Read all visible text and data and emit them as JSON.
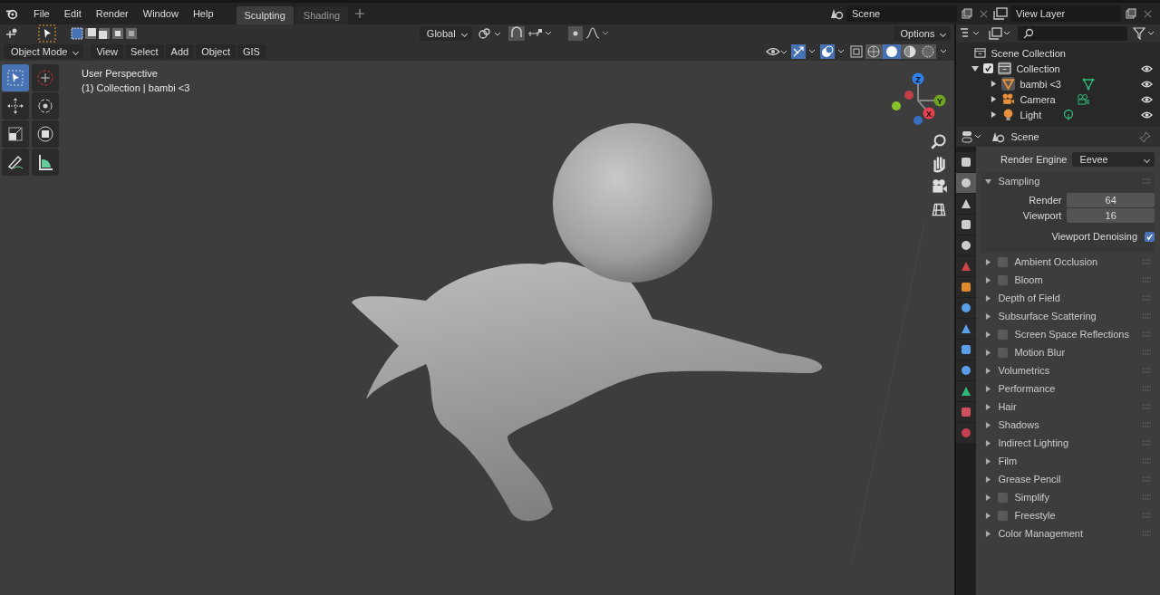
{
  "top_bar": {
    "menus": [
      "File",
      "Edit",
      "Render",
      "Window",
      "Help"
    ],
    "workspaces": [
      {
        "label": "Sculpting",
        "selected": true
      },
      {
        "label": "Shading",
        "selected": false
      }
    ],
    "scene": "Scene",
    "view_layer": "View Layer"
  },
  "tool_header": {
    "orientation": "Global",
    "options": "Options"
  },
  "viewport_header": {
    "mode": "Object Mode",
    "menus": [
      "View",
      "Select",
      "Add",
      "Object",
      "GIS"
    ]
  },
  "viewport": {
    "overlay_text": [
      "User Perspective",
      "(1) Collection | bambi <3"
    ],
    "tools": [
      {
        "kind": "select",
        "selected": true
      },
      {
        "kind": "cursor",
        "selected": false
      },
      {
        "kind": "move",
        "selected": false
      },
      {
        "kind": "rotate",
        "selected": false
      },
      {
        "kind": "scale",
        "selected": false
      },
      {
        "kind": "transform",
        "selected": false
      },
      {
        "kind": "annotate",
        "selected": false
      },
      {
        "kind": "measure",
        "selected": false
      }
    ],
    "gizmo_axes": [
      {
        "label": "Z",
        "color": "#2f7fe8"
      },
      {
        "label": "Y",
        "color": "#6ea21f"
      },
      {
        "label": "X",
        "color": "#e8414f"
      }
    ]
  },
  "outliner": {
    "root": "Scene Collection",
    "items": [
      {
        "label": "Collection",
        "kind": "collection",
        "checked": true,
        "expanded": true,
        "children": [
          {
            "label": "bambi <3",
            "kind": "mesh",
            "expanded": false
          },
          {
            "label": "Camera",
            "kind": "camera",
            "expanded": false
          },
          {
            "label": "Light",
            "kind": "light",
            "expanded": false
          }
        ]
      }
    ]
  },
  "properties": {
    "context": "Scene",
    "tabs": [
      {
        "kind": "tool",
        "selected": false
      },
      {
        "kind": "render",
        "selected": true
      },
      {
        "kind": "output",
        "selected": false
      },
      {
        "kind": "view_layer",
        "selected": false
      },
      {
        "kind": "scene",
        "selected": false
      },
      {
        "kind": "world",
        "selected": false
      },
      {
        "kind": "object",
        "selected": false
      },
      {
        "kind": "modifier",
        "selected": false
      },
      {
        "kind": "particles",
        "selected": false
      },
      {
        "kind": "physics",
        "selected": false
      },
      {
        "kind": "constraint",
        "selected": false
      },
      {
        "kind": "data",
        "selected": false
      },
      {
        "kind": "material",
        "selected": false
      },
      {
        "kind": "texture",
        "selected": false
      }
    ],
    "render_engine": {
      "label": "Render Engine",
      "value": "Eevee"
    },
    "panels": [
      {
        "title": "Sampling",
        "expanded": true,
        "fields": [
          {
            "label": "Render",
            "value": "64"
          },
          {
            "label": "Viewport",
            "value": "16"
          }
        ],
        "toggle": {
          "label": "Viewport Denoising",
          "checked": true
        }
      },
      {
        "title": "Ambient Occlusion",
        "expanded": false,
        "checked": false
      },
      {
        "title": "Bloom",
        "expanded": false,
        "checked": false
      },
      {
        "title": "Depth of Field",
        "expanded": false
      },
      {
        "title": "Subsurface Scattering",
        "expanded": false
      },
      {
        "title": "Screen Space Reflections",
        "expanded": false,
        "checked": false
      },
      {
        "title": "Motion Blur",
        "expanded": false,
        "checked": false
      },
      {
        "title": "Volumetrics",
        "expanded": false
      },
      {
        "title": "Performance",
        "expanded": false
      },
      {
        "title": "Hair",
        "expanded": false
      },
      {
        "title": "Shadows",
        "expanded": false
      },
      {
        "title": "Indirect Lighting",
        "expanded": false
      },
      {
        "title": "Film",
        "expanded": false
      },
      {
        "title": "Grease Pencil",
        "expanded": false
      },
      {
        "title": "Simplify",
        "expanded": false,
        "checked": false
      },
      {
        "title": "Freestyle",
        "expanded": false,
        "checked": false
      },
      {
        "title": "Color Management",
        "expanded": false
      }
    ]
  }
}
